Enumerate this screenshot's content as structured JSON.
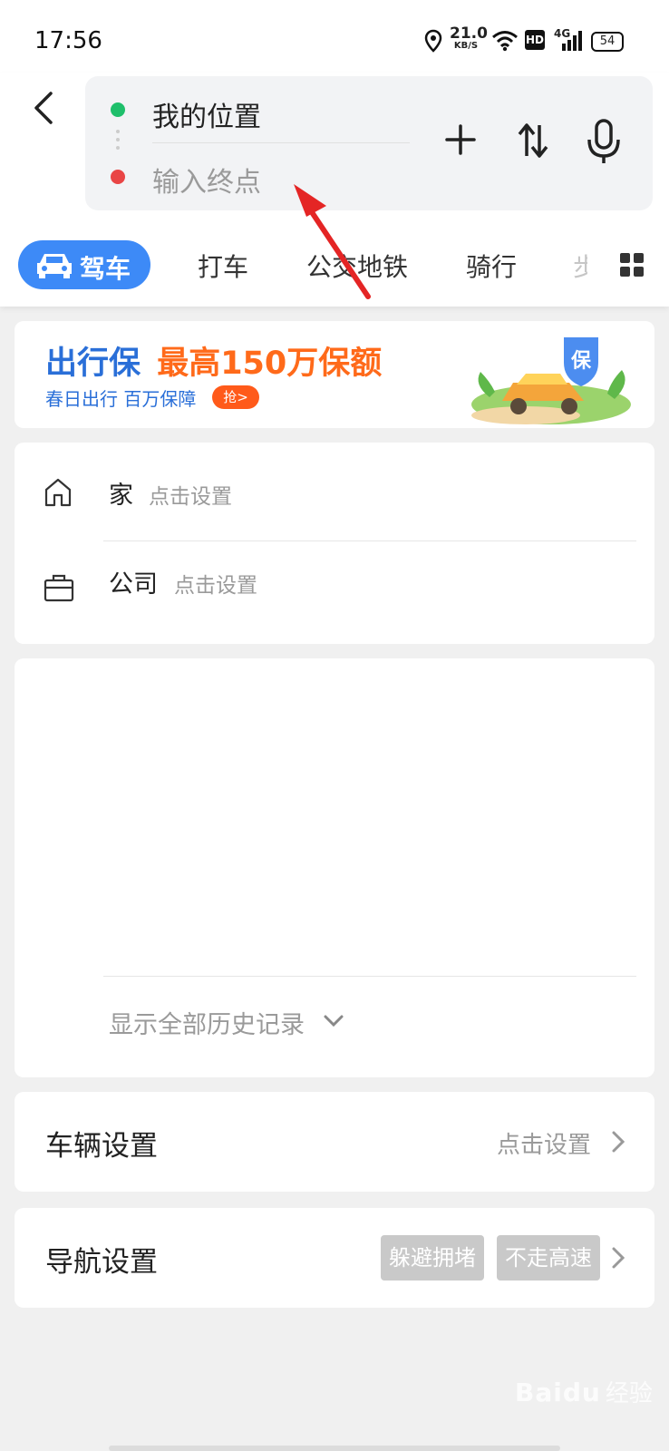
{
  "status_bar": {
    "time": "17:56",
    "net_speed_value": "21.0",
    "net_speed_unit": "KB/S",
    "hd_badge": "HD",
    "network_type": "4G",
    "battery": "54"
  },
  "route": {
    "origin": "我的位置",
    "destination_placeholder": "输入终点"
  },
  "tabs": [
    "驾车",
    "打车",
    "公交地铁",
    "骑行",
    "步"
  ],
  "banner": {
    "title_part1": "出行保",
    "title_part2": "最高150万保额",
    "subtitle": "春日出行 百万保障",
    "button": "抢>",
    "badge": "保"
  },
  "favorites": [
    {
      "name": "家",
      "hint": "点击设置"
    },
    {
      "name": "公司",
      "hint": "点击设置"
    }
  ],
  "history": {
    "show_all": "显示全部历史记录"
  },
  "vehicle_settings": {
    "label": "车辆设置",
    "value": "点击设置"
  },
  "nav_settings": {
    "label": "导航设置",
    "chips": [
      "躲避拥堵",
      "不走高速"
    ]
  },
  "watermark": {
    "brand": "Baidu",
    "text": "经验"
  },
  "colors": {
    "accent": "#3d8af7",
    "origin_dot": "#1fbf6b",
    "dest_dot": "#e94545",
    "arrow": "#e42525",
    "banner_blue": "#2a6fd8",
    "banner_orange": "#ff6a1a"
  }
}
